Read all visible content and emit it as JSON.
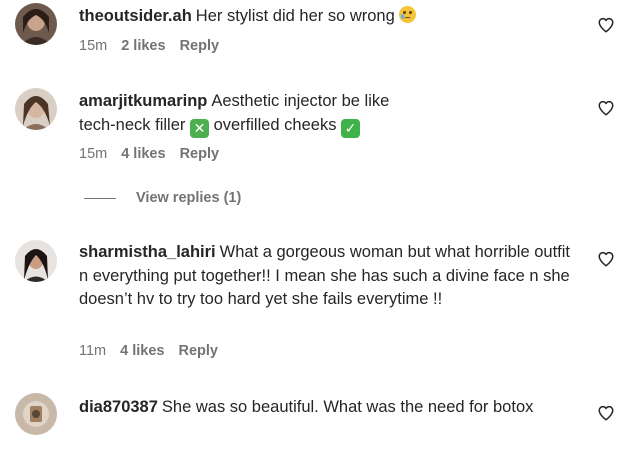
{
  "comments": [
    {
      "username": "theoutsider.ah",
      "text": "Her stylist did her so wrong",
      "emoji": "sad-tear-emoji",
      "time": "15m",
      "likes": "2 likes",
      "reply": "Reply"
    },
    {
      "username": "amarjitkumarinp",
      "text_part1": "Aesthetic injector be like",
      "text_part2": "tech-neck filler",
      "emoji1": "cross-mark-emoji",
      "text_part3": "overfilled cheeks",
      "emoji2": "check-mark-emoji",
      "time": "15m",
      "likes": "4 likes",
      "reply": "Reply",
      "view_replies": "View replies (1)"
    },
    {
      "username": "sharmistha_lahiri",
      "text": "What a gorgeous woman but what horrible outfit n everything put together!! I mean she has such a divine face n she doesn’t hv to try too hard yet she fails everytime !!",
      "time": "11m",
      "likes": "4 likes",
      "reply": "Reply"
    },
    {
      "username": "dia870387",
      "text": "She was so beautiful. What was the need for botox"
    }
  ],
  "icons": {
    "like": "heart-outline-icon",
    "x_glyph": "✕",
    "check_glyph": "✓"
  },
  "colors": {
    "text": "#262626",
    "muted": "#737373",
    "emoji_green": "#4caf50"
  }
}
